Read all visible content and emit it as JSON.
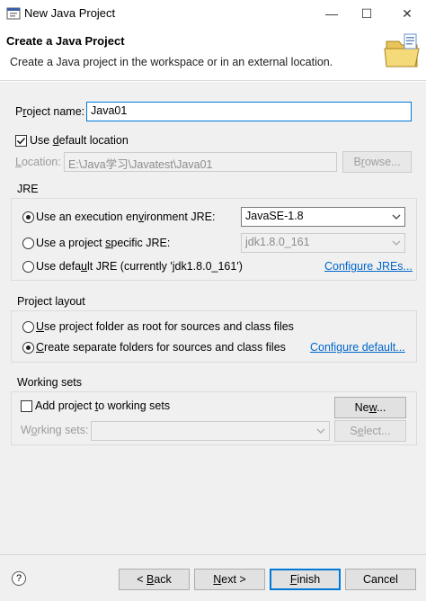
{
  "window": {
    "title": "New Java Project",
    "minimize_glyph": "—",
    "maximize_glyph": "☐",
    "close_glyph": "✕"
  },
  "banner": {
    "title": "Create a Java Project",
    "description": "Create a Java project in the workspace or in an external location.",
    "icon": "new-project-folder-icon"
  },
  "project": {
    "name_label_pre": "P",
    "name_label_u": "r",
    "name_label_post": "oject name:",
    "name_value": "Java01"
  },
  "location": {
    "use_default_pre": "Use ",
    "use_default_u": "d",
    "use_default_post": "efault location",
    "use_default_checked": true,
    "label_pre": "",
    "label_u": "L",
    "label_post": "ocation:",
    "path": "E:\\Java学习\\Javatest\\Java01",
    "browse_pre": "B",
    "browse_u": "r",
    "browse_post": "owse..."
  },
  "jre": {
    "group_title": "JRE",
    "exec_env_pre": "Use an execution en",
    "exec_env_u": "v",
    "exec_env_post": "ironment JRE:",
    "exec_env_value": "JavaSE-1.8",
    "project_specific_pre": "Use a project ",
    "project_specific_u": "s",
    "project_specific_post": "pecific JRE:",
    "project_specific_value": "jdk1.8.0_161",
    "default_pre": "Use defa",
    "default_u": "u",
    "default_post": "lt JRE (currently 'jdk1.8.0_161')",
    "configure_pre": "Configure ",
    "configure_u": "J",
    "configure_post": "REs..."
  },
  "layout": {
    "group_title": "Project layout",
    "root_pre": "",
    "root_u": "U",
    "root_post": "se project folder as root for sources and class files",
    "separate_pre": "",
    "separate_u": "C",
    "separate_post": "reate separate folders for sources and class files",
    "configure_pre": "Configure ",
    "configure_u": "d",
    "configure_post": "efault..."
  },
  "working_sets": {
    "group_title": "Working sets",
    "add_pre": "Add project ",
    "add_u": "t",
    "add_post": "o working sets",
    "new_pre": "Ne",
    "new_u": "w",
    "new_post": "...",
    "label_pre": "W",
    "label_u": "o",
    "label_post": "rking sets:",
    "select_pre": "S",
    "select_u": "e",
    "select_post": "lect..."
  },
  "footer": {
    "help_glyph": "?",
    "back_pre": "< ",
    "back_u": "B",
    "back_post": "ack",
    "next_pre": "",
    "next_u": "N",
    "next_post": "ext >",
    "finish_pre": "",
    "finish_u": "F",
    "finish_post": "inish",
    "cancel": "Cancel"
  },
  "colors": {
    "link": "#0066cc",
    "focus": "#0078d7",
    "background": "#f0f0f0"
  }
}
